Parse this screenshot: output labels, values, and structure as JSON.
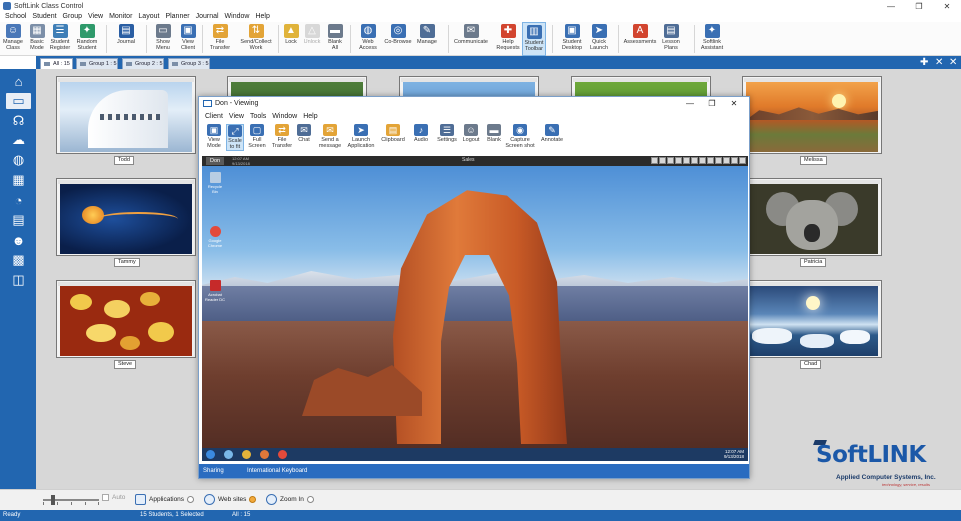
{
  "window": {
    "title": "SoftLink Class Control",
    "controls": [
      "—",
      "❐",
      "✕"
    ]
  },
  "menu": [
    "School",
    "Student",
    "Group",
    "View",
    "Monitor",
    "Layout",
    "Planner",
    "Journal",
    "Window",
    "Help"
  ],
  "ribbon": [
    {
      "label": "Manage\nClass",
      "icon": "manage-class-icon",
      "color": "#4a78b8",
      "glyph": "☺"
    },
    {
      "label": "Basic\nMode",
      "icon": "basic-mode-icon",
      "color": "#7c8fa8",
      "glyph": "▦"
    },
    {
      "label": "Student\nRegister",
      "icon": "student-register-icon",
      "color": "#3f7fb7",
      "glyph": "☰"
    },
    {
      "label": "Random\nStudent",
      "icon": "random-student-icon",
      "color": "#2f9a6b",
      "glyph": "✦"
    },
    {
      "label": "Journal",
      "icon": "journal-icon",
      "color": "#2a5ea3",
      "glyph": "▤"
    },
    {
      "label": "Show\nMenu",
      "icon": "show-menu-icon",
      "color": "#6c7a8c",
      "glyph": "▭"
    },
    {
      "label": "View\nClient",
      "icon": "view-client-icon",
      "color": "#3a6fb3",
      "glyph": "▣"
    },
    {
      "label": "File\nTransfer",
      "icon": "file-transfer-icon",
      "color": "#e3a437",
      "glyph": "⇄"
    },
    {
      "label": "Send/Collect\nWork",
      "icon": "send-collect-icon",
      "color": "#e3a437",
      "glyph": "⇅"
    },
    {
      "label": "Lock",
      "icon": "lock-icon",
      "color": "#e0b33a",
      "glyph": "▲"
    },
    {
      "label": "Unlock",
      "icon": "unlock-icon",
      "color": "#d8d8d8",
      "glyph": "△"
    },
    {
      "label": "Blank\nAll",
      "icon": "blank-all-icon",
      "color": "#6c7a8c",
      "glyph": "▬"
    },
    {
      "label": "Web\nAccess",
      "icon": "web-access-icon",
      "color": "#3a6fb3",
      "glyph": "◍"
    },
    {
      "label": "Co-Browse",
      "icon": "co-browse-icon",
      "color": "#3a6fb3",
      "glyph": "◎"
    },
    {
      "label": "Manage",
      "icon": "manage-apps-icon",
      "color": "#4f6d96",
      "glyph": "✎"
    },
    {
      "label": "Communicate",
      "icon": "communicate-icon",
      "color": "#6c7a8c",
      "glyph": "✉"
    },
    {
      "label": "Help\nRequests",
      "icon": "help-requests-icon",
      "color": "#d2452f",
      "glyph": "✚"
    },
    {
      "label": "Student\nToolbar",
      "icon": "student-toolbar-icon",
      "color": "#3a6fb3",
      "glyph": "▥"
    },
    {
      "label": "Student\nDesktop",
      "icon": "student-desktop-icon",
      "color": "#3a6fb3",
      "glyph": "▣"
    },
    {
      "label": "Quick\nLaunch",
      "icon": "quick-launch-icon",
      "color": "#3a6fb3",
      "glyph": "➤"
    },
    {
      "label": "Assessments",
      "icon": "assessments-icon",
      "color": "#d2452f",
      "glyph": "A"
    },
    {
      "label": "Lesson\nPlans",
      "icon": "lesson-plans-icon",
      "color": "#4f6d96",
      "glyph": "▤"
    },
    {
      "label": "Softlink\nAssistant",
      "icon": "softlink-assistant-icon",
      "color": "#3a6fb3",
      "glyph": "✦"
    }
  ],
  "tabs": [
    {
      "label": "All : 15",
      "active": true
    },
    {
      "label": "Group 1 : 5",
      "active": false
    },
    {
      "label": "Group 2 : 5",
      "active": false
    },
    {
      "label": "Group 3 : 5",
      "active": false
    }
  ],
  "tab_buttons": [
    "✚",
    "✕",
    "✕"
  ],
  "sidebar_icons": [
    "home-icon",
    "monitor-icon",
    "headphones-icon",
    "brain-icon",
    "globe-icon",
    "grid-icon",
    "pie-chart-icon",
    "printer-icon",
    "people-icon",
    "quiz-icon",
    "presentation-icon"
  ],
  "students": [
    "Todd",
    "Melissa",
    "Tammy",
    "Patricia",
    "Steve",
    "Chad"
  ],
  "viewing": {
    "title": "Don - Viewing",
    "menu": [
      "Client",
      "View",
      "Tools",
      "Window",
      "Help"
    ],
    "toolbar": [
      {
        "label": "View\nMode",
        "icon": "view-mode-icon",
        "color": "#3a6fb3",
        "glyph": "▣"
      },
      {
        "label": "Scale\nto fit",
        "icon": "scale-to-fit-icon",
        "color": "#3a6fb3",
        "glyph": "⤢"
      },
      {
        "label": "Full\nScreen",
        "icon": "full-screen-icon",
        "color": "#3a6fb3",
        "glyph": "▢"
      },
      {
        "label": "File\nTransfer",
        "icon": "file-transfer-icon",
        "color": "#e3a437",
        "glyph": "⇄"
      },
      {
        "label": "Chat",
        "icon": "chat-icon",
        "color": "#4f6d96",
        "glyph": "✉"
      },
      {
        "label": "Send a\nmessage",
        "icon": "send-message-icon",
        "color": "#e3a437",
        "glyph": "✉"
      },
      {
        "label": "Launch\nApplication",
        "icon": "launch-application-icon",
        "color": "#3a6fb3",
        "glyph": "➤"
      },
      {
        "label": "Clipboard",
        "icon": "clipboard-icon",
        "color": "#e3a437",
        "glyph": "▤"
      },
      {
        "label": "Audio",
        "icon": "audio-icon",
        "color": "#3a6fb3",
        "glyph": "♪"
      },
      {
        "label": "Settings",
        "icon": "settings-icon",
        "color": "#4f6d96",
        "glyph": "☰"
      },
      {
        "label": "Logout",
        "icon": "logout-icon",
        "color": "#6c7a8c",
        "glyph": "☺"
      },
      {
        "label": "Blank",
        "icon": "blank-icon",
        "color": "#6c7a8c",
        "glyph": "▬"
      },
      {
        "label": "Capture\nScreen shot",
        "icon": "capture-icon",
        "color": "#3a6fb3",
        "glyph": "◉"
      },
      {
        "label": "Annotate",
        "icon": "annotate-icon",
        "color": "#3a6fb3",
        "glyph": "✎"
      }
    ],
    "desktop_user": "Don",
    "desktop_clock_top": "12:07 AM\n9/13/2018",
    "desktop_center": "Sales",
    "desktop_icons": [
      {
        "label": "Recycle Bin",
        "color": "#b8cde3"
      },
      {
        "label": "Google Chrome",
        "color": "#e34a3b"
      },
      {
        "label": "Acrobat Reader DC",
        "color": "#c62a2a"
      }
    ],
    "taskbar_clock": "12:07 AM\n9/13/2018",
    "status": "Sharing",
    "keyboard": "International Keyboard"
  },
  "logo": {
    "word": "SoftLINK",
    "company": "Applied Computer Systems, Inc.",
    "tagline": "technology, service, results"
  },
  "bottom": {
    "auto": "Auto",
    "applications": "Applications",
    "websites": "Web sites",
    "zoom": "Zoom In"
  },
  "status": {
    "ready": "Ready",
    "count": "15 Students, 1 Selected",
    "group": "All : 15"
  }
}
